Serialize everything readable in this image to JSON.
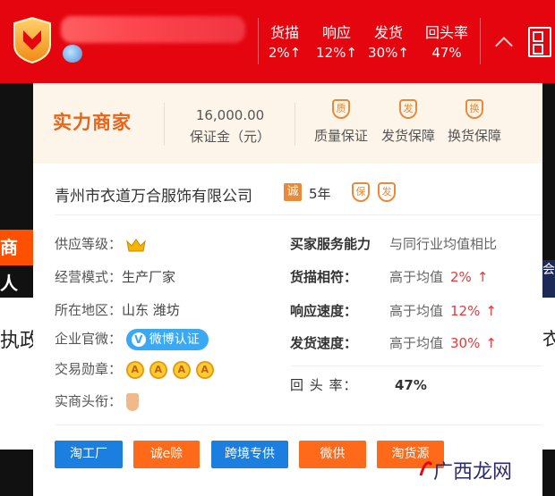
{
  "header": {
    "stats": [
      {
        "label": "货描",
        "value": "2%↑"
      },
      {
        "label": "响应",
        "value": "12%↑"
      },
      {
        "label": "发货",
        "value": "30%↑"
      },
      {
        "label": "回头率",
        "value": "47%"
      }
    ]
  },
  "background": {
    "left_band_text": "商人",
    "left_white_text": "执政",
    "right_band_text": "会",
    "right_white_text": "衣"
  },
  "card": {
    "strength_title": "实力商家",
    "deposit_amount": "16,000.00",
    "deposit_label": "保证金（元）",
    "guarantees": [
      {
        "icon": "质",
        "label": "质量保证"
      },
      {
        "icon": "发",
        "label": "发货保障"
      },
      {
        "icon": "换",
        "label": "换货保障"
      }
    ],
    "company_name": "青州市衣道万合服饰有限公司",
    "cheng_badge": "诚",
    "years": "5年",
    "small_icons": [
      "保",
      "发"
    ],
    "left_info": {
      "supplier_level_label": "供应等级：",
      "business_mode_label": "经营模式：",
      "business_mode_value": "生产厂家",
      "region_label": "所在地区：",
      "region_value": "山东 潍坊",
      "weibo_label": "企业官微：",
      "weibo_badge": "微博认证",
      "medals_label": "交易勋章：",
      "medal_letters": [
        "A",
        "A",
        "A",
        "A"
      ],
      "title_label": "实商头衔："
    },
    "right_info": {
      "header_key": "买家服务能力",
      "header_value": "与同行业均值相比",
      "rows": [
        {
          "key": "货描相符：",
          "compare": "高于均值",
          "pct": "2%",
          "arrow": "↑"
        },
        {
          "key": "响应速度：",
          "compare": "高于均值",
          "pct": "12%",
          "arrow": "↑"
        },
        {
          "key": "发货速度：",
          "compare": "高于均值",
          "pct": "30%",
          "arrow": "↑"
        }
      ],
      "return_key": "回 头 率：",
      "return_value": "47%"
    },
    "buttons": [
      {
        "label": "淘工厂",
        "color": "#1c7fe0"
      },
      {
        "label": "诚e赊",
        "color": "#ff6a1a"
      },
      {
        "label": "跨境专供",
        "color": "#1c7fe0"
      },
      {
        "label": "微供",
        "color": "#ff6a1a"
      },
      {
        "label": "淘货源",
        "color": "#ff6a1a"
      }
    ]
  },
  "watermark": "广西龙网"
}
